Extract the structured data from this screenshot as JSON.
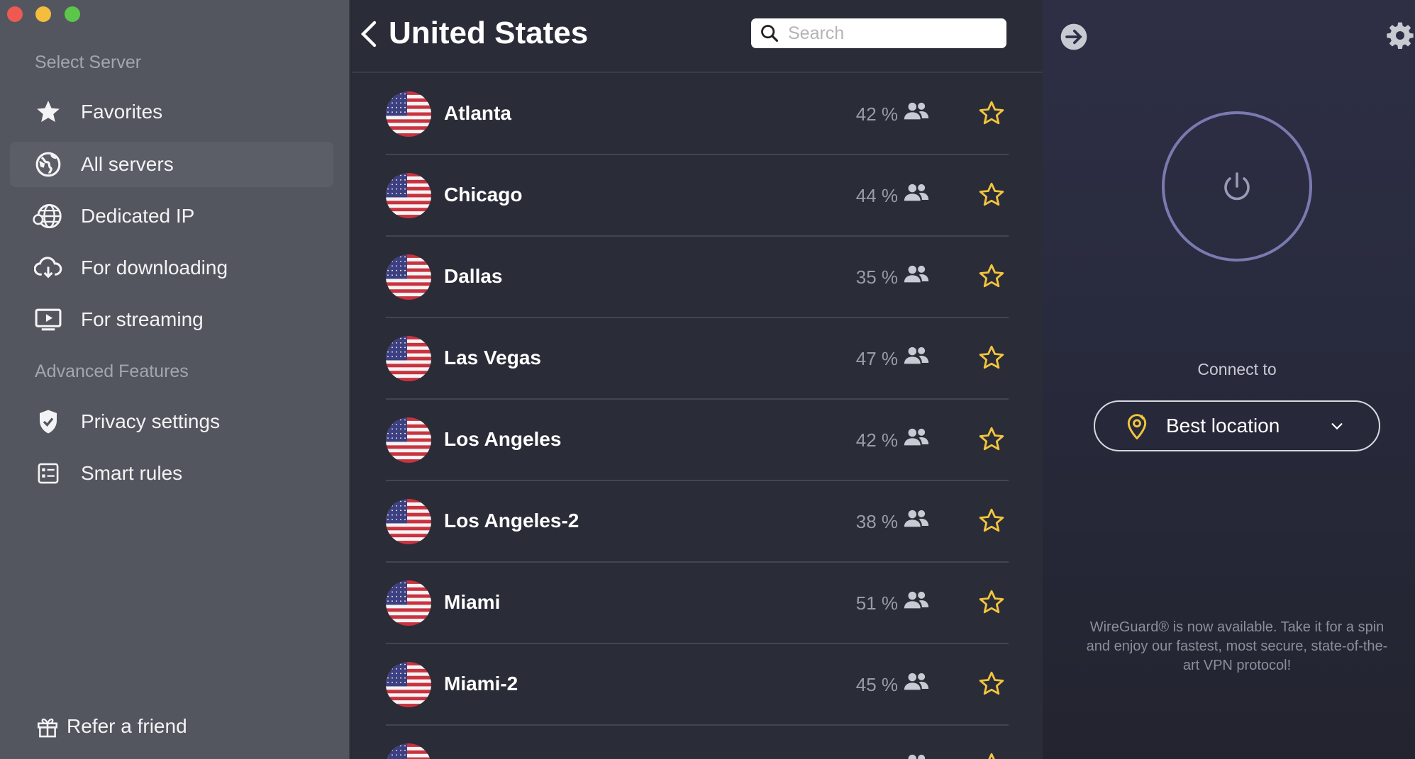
{
  "sidebar": {
    "select_server_title": "Select Server",
    "items": [
      {
        "label": "Favorites",
        "icon": "star-icon"
      },
      {
        "label": "All servers",
        "icon": "globe-icon"
      },
      {
        "label": "Dedicated IP",
        "icon": "globe-ip-icon"
      },
      {
        "label": "For downloading",
        "icon": "cloud-download-icon"
      },
      {
        "label": "For streaming",
        "icon": "play-screen-icon"
      }
    ],
    "advanced_title": "Advanced Features",
    "advanced_items": [
      {
        "label": "Privacy settings",
        "icon": "shield-check-icon"
      },
      {
        "label": "Smart rules",
        "icon": "rules-list-icon"
      }
    ],
    "refer_label": "Refer a friend"
  },
  "list": {
    "title": "United States",
    "search_placeholder": "Search",
    "servers": [
      {
        "city": "Atlanta",
        "load": "42 %"
      },
      {
        "city": "Chicago",
        "load": "44 %"
      },
      {
        "city": "Dallas",
        "load": "35 %"
      },
      {
        "city": "Las Vegas",
        "load": "47 %"
      },
      {
        "city": "Los Angeles",
        "load": "42 %"
      },
      {
        "city": "Los Angeles-2",
        "load": "38 %"
      },
      {
        "city": "Miami",
        "load": "51 %"
      },
      {
        "city": "Miami-2",
        "load": "45 %"
      }
    ]
  },
  "connect": {
    "connect_to_label": "Connect to",
    "location_label": "Best location",
    "notice": "WireGuard® is now available. Take it for a spin and enjoy our fastest, most secure, state-of-the-art VPN protocol!"
  },
  "colors": {
    "sidebar_bg": "#54565f",
    "list_bg": "#2a2c38",
    "star_accent": "#f2c53d",
    "ring": "#7a7ab0"
  }
}
